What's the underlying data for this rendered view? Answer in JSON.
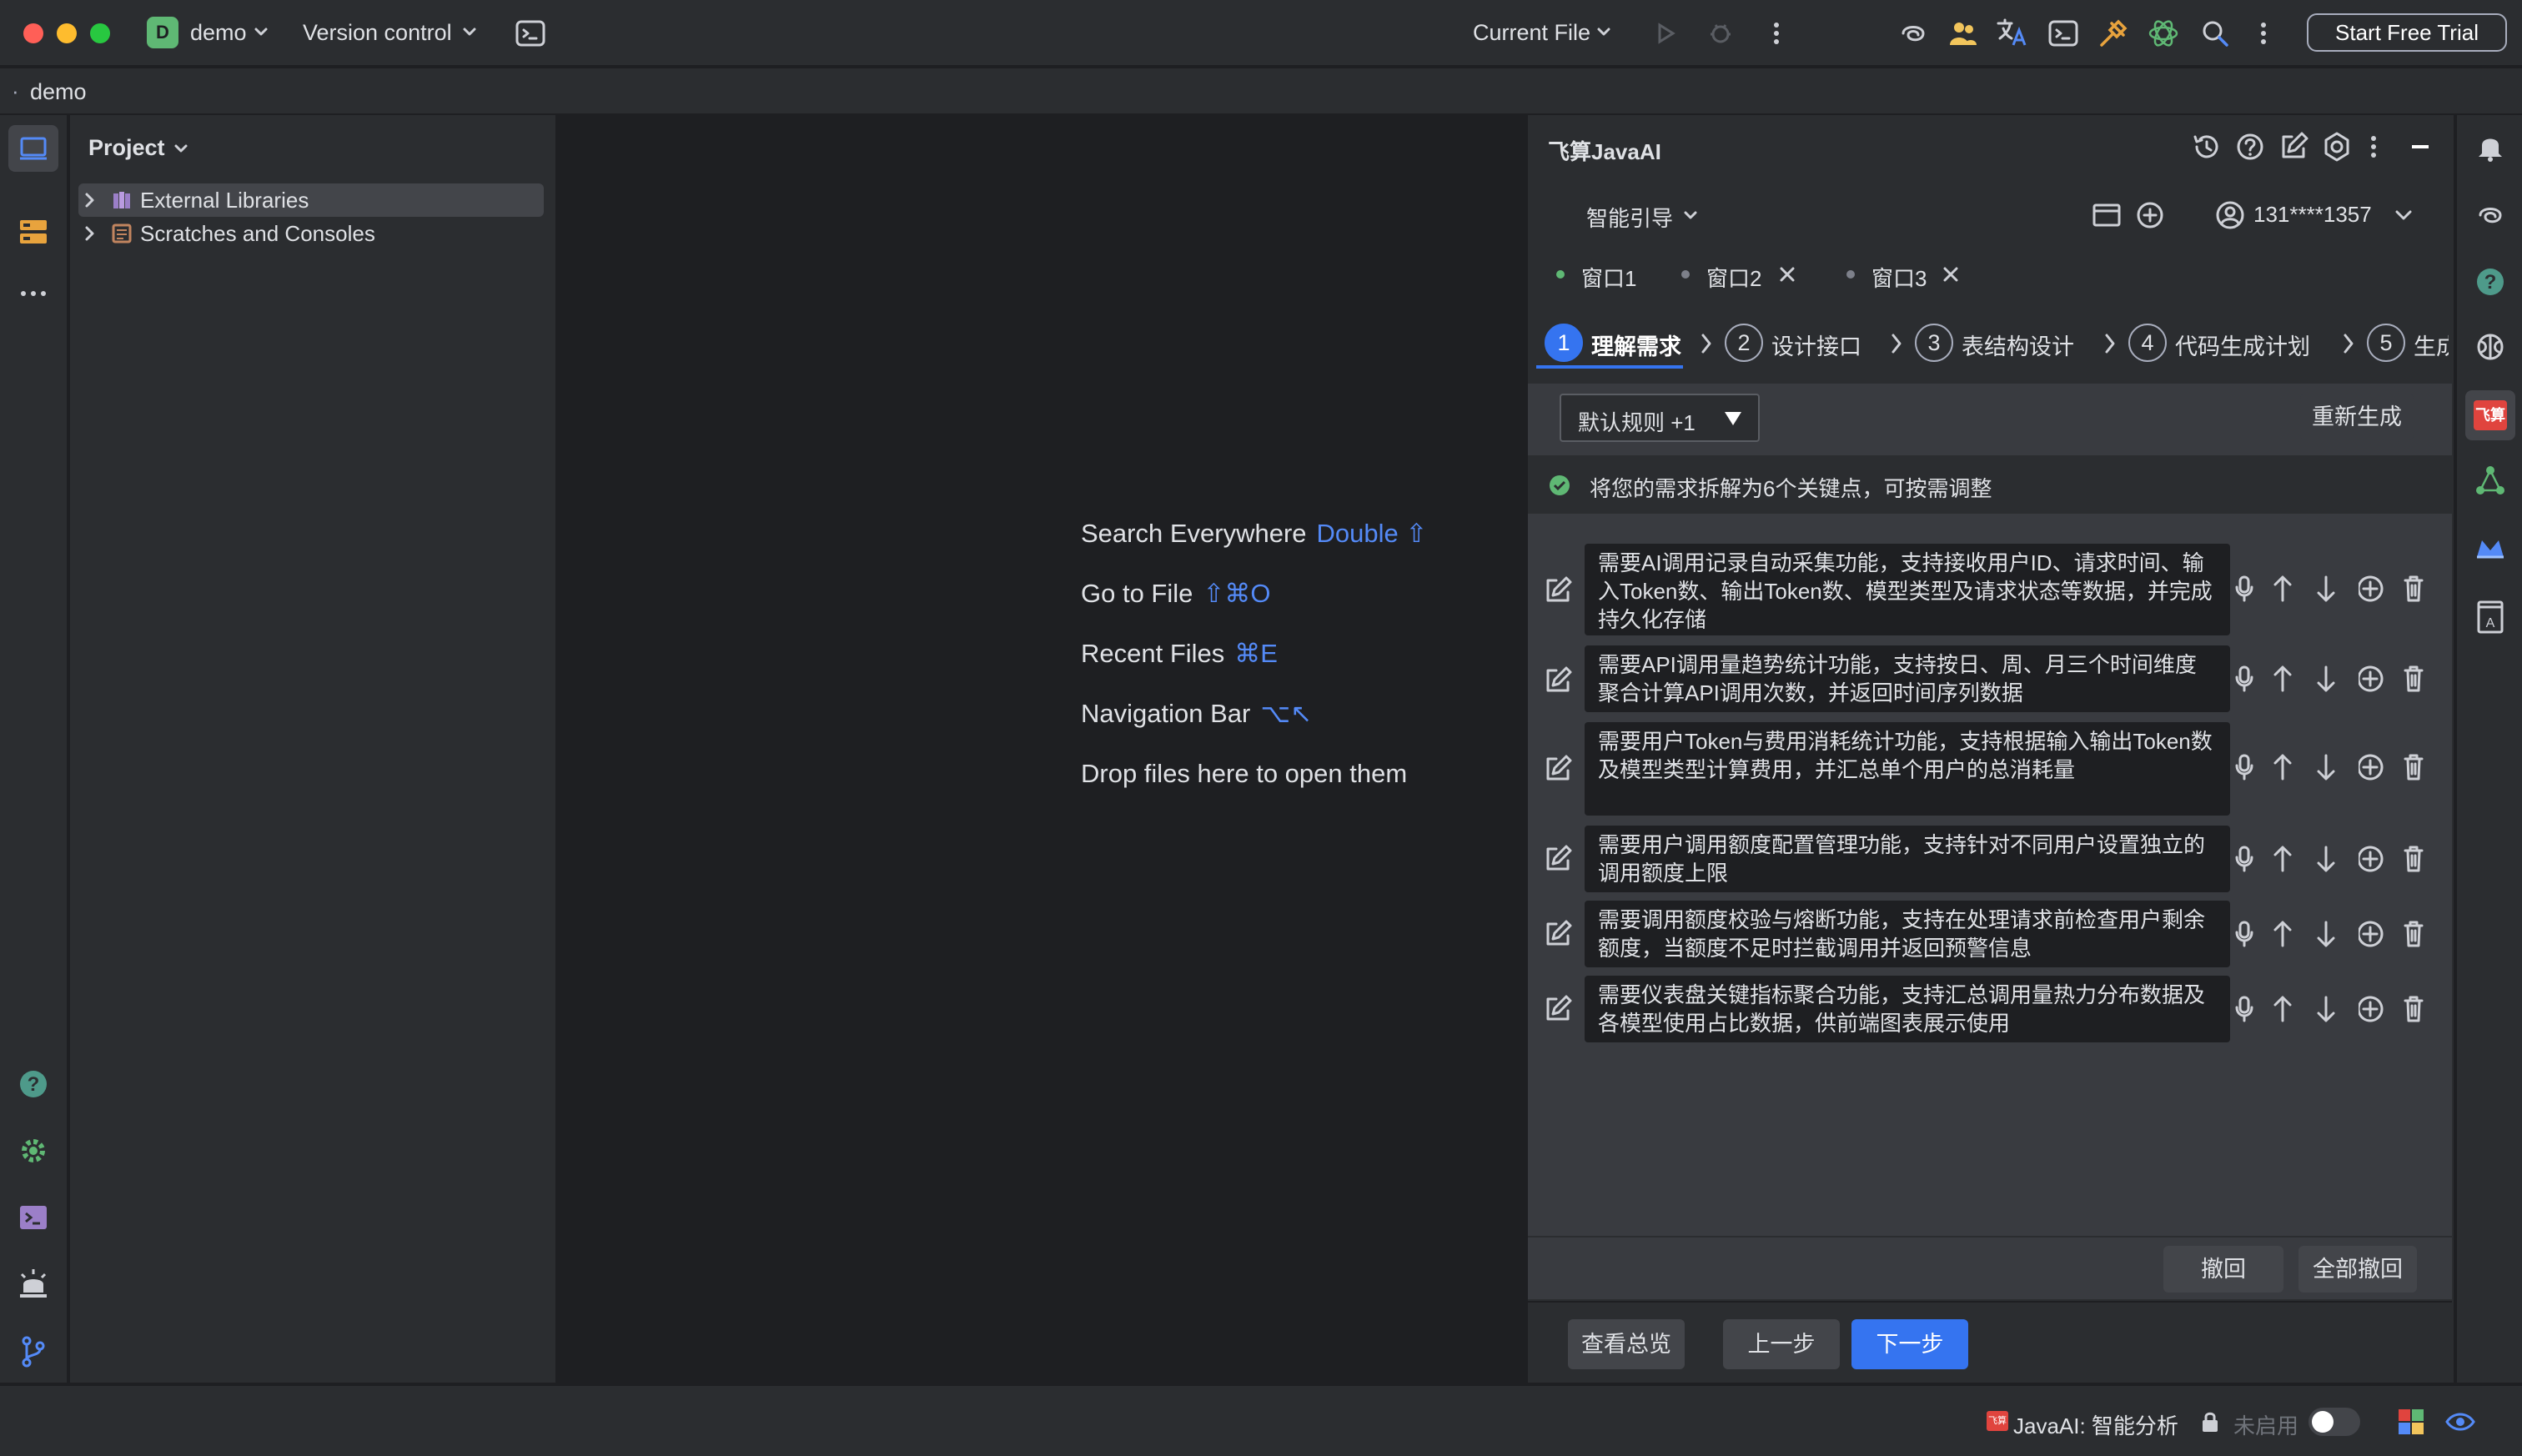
{
  "titlebar": {
    "project_badge": "D",
    "project_name": "demo",
    "vcs_label": "Version control",
    "run_config": "Current File",
    "trial_button": "Start Free Trial"
  },
  "breadcrumb": {
    "dot": "·",
    "project": "demo"
  },
  "project_panel": {
    "title": "Project",
    "items": [
      {
        "label": "External Libraries"
      },
      {
        "label": "Scratches and Consoles"
      }
    ]
  },
  "editor_hints": [
    {
      "label": "Search Everywhere",
      "shortcut": "Double ⇧"
    },
    {
      "label": "Go to File",
      "shortcut": "⇧⌘O"
    },
    {
      "label": "Recent Files",
      "shortcut": "⌘E"
    },
    {
      "label": "Navigation Bar",
      "shortcut": "⌥↖"
    },
    {
      "label": "Drop files here to open them",
      "shortcut": ""
    }
  ],
  "ai_panel": {
    "title": "飞算JavaAI",
    "mode": "智能引导",
    "account": "131****1357",
    "tabs": [
      {
        "label": "窗口1",
        "active": true
      },
      {
        "label": "窗口2",
        "active": false
      },
      {
        "label": "窗口3",
        "active": false
      }
    ],
    "steps": [
      {
        "num": "1",
        "label": "理解需求"
      },
      {
        "num": "2",
        "label": "设计接口"
      },
      {
        "num": "3",
        "label": "表结构设计"
      },
      {
        "num": "4",
        "label": "代码生成计划"
      },
      {
        "num": "5",
        "label": "生成"
      }
    ],
    "rule_select": "默认规则 +1",
    "regenerate": "重新生成",
    "summary": "将您的需求拆解为6个关键点，可按需调整",
    "items": [
      "需要AI调用记录自动采集功能，支持接收用户ID、请求时间、输入Token数、输出Token数、模型类型及请求状态等数据，并完成持久化存储",
      "需要API调用量趋势统计功能，支持按日、周、月三个时间维度聚合计算API调用次数，并返回时间序列数据",
      "需要用户Token与费用消耗统计功能，支持根据输入输出Token数及模型类型计算费用，并汇总单个用户的总消耗量",
      "需要用户调用额度配置管理功能，支持针对不同用户设置独立的调用额度上限",
      "需要调用额度校验与熔断功能，支持在处理请求前检查用户剩余额度，当额度不足时拦截调用并返回预警信息",
      "需要仪表盘关键指标聚合功能，支持汇总调用量热力分布数据及各模型使用占比数据，供前端图表展示使用"
    ],
    "undo": "撤回",
    "undo_all": "全部撤回",
    "overview": "查看总览",
    "prev": "上一步",
    "next": "下一步"
  },
  "statusbar": {
    "plugin_label": "JavaAI: 智能分析",
    "plugin_state": "未启用"
  },
  "colors": {
    "accent": "#3574f0",
    "link": "#548af7",
    "success": "#5fb874",
    "brand_red": "#e0443e"
  }
}
